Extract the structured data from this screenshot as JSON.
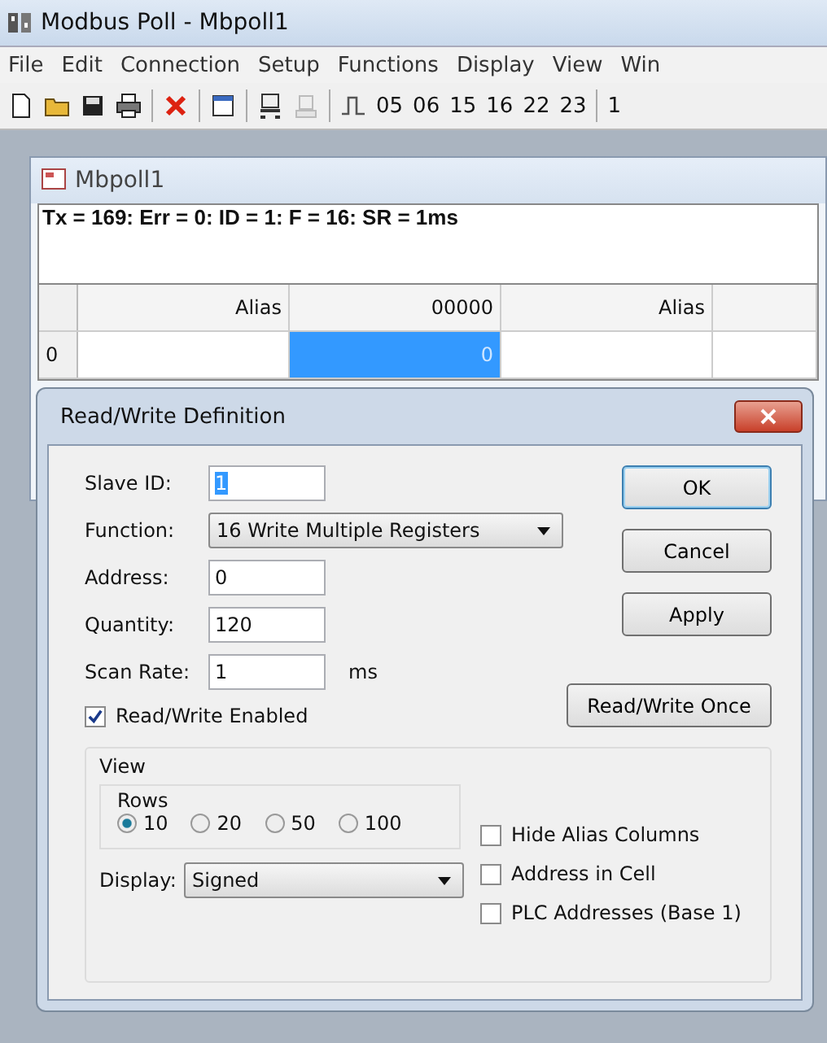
{
  "window": {
    "title": "Modbus Poll - Mbpoll1"
  },
  "menu": [
    {
      "label": "File"
    },
    {
      "label": "Edit"
    },
    {
      "label": "Connection"
    },
    {
      "label": "Setup"
    },
    {
      "label": "Functions"
    },
    {
      "label": "Display"
    },
    {
      "label": "View"
    },
    {
      "label": "Win"
    }
  ],
  "toolbar": {
    "function_codes": [
      "05",
      "06",
      "15",
      "16",
      "22",
      "23",
      "1"
    ]
  },
  "child_window": {
    "title": "Mbpoll1",
    "status": "Tx = 169: Err = 0: ID = 1: F = 16: SR = 1ms",
    "table": {
      "columns": [
        "Alias",
        "00000",
        "Alias"
      ],
      "rows": [
        {
          "label": "0",
          "cells": [
            {
              "selected": false
            },
            {
              "value": "0",
              "selected": true
            },
            {
              "selected": false
            }
          ]
        }
      ]
    }
  },
  "dialog": {
    "title": "Read/Write Definition",
    "fields": [
      {
        "label": "Slave ID:",
        "value": "1",
        "kind": "text",
        "highlighted": true
      },
      {
        "label": "Function:",
        "value": "16 Write Multiple Registers",
        "kind": "select"
      },
      {
        "label": "Address:",
        "value": "0",
        "kind": "text",
        "highlighted": false
      },
      {
        "label": "Quantity:",
        "value": "120",
        "kind": "text",
        "highlighted": false
      },
      {
        "label": "Scan Rate:",
        "value": "1",
        "kind": "text",
        "unit": "ms",
        "highlighted": false
      }
    ],
    "enabled": {
      "label": "Read/Write Enabled",
      "checked": true
    },
    "buttons": [
      {
        "label": "OK",
        "default": true
      },
      {
        "label": "Cancel",
        "default": false
      },
      {
        "label": "Apply",
        "default": false
      }
    ],
    "once_button": "Read/Write Once",
    "view": {
      "title": "View",
      "rows_group": {
        "title": "Rows",
        "options": [
          {
            "label": "10",
            "selected": true
          },
          {
            "label": "20",
            "selected": false
          },
          {
            "label": "50",
            "selected": false
          },
          {
            "label": "100",
            "selected": false
          }
        ]
      },
      "display": {
        "label": "Display:",
        "value": "Signed"
      },
      "options": [
        {
          "label": "Hide Alias Columns",
          "checked": false
        },
        {
          "label": "Address in Cell",
          "checked": false
        },
        {
          "label": "PLC Addresses (Base 1)",
          "checked": false
        }
      ]
    }
  }
}
